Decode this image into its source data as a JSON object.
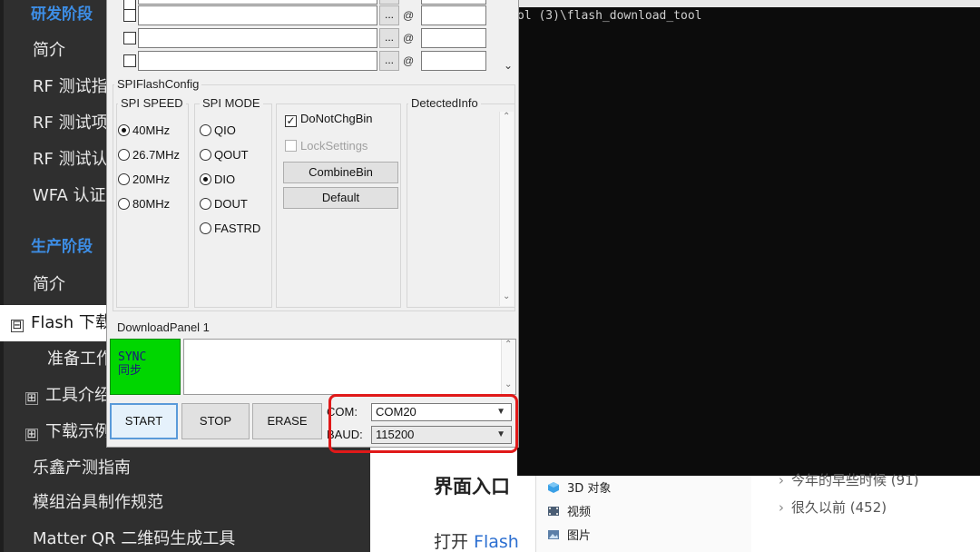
{
  "sidebar": {
    "items": [
      {
        "label": "研发阶段",
        "type": "section"
      },
      {
        "label": "简介",
        "type": "link"
      },
      {
        "label": "RF 测试指",
        "type": "link"
      },
      {
        "label": "RF 测试项",
        "type": "link"
      },
      {
        "label": "RF 测试认",
        "type": "link"
      },
      {
        "label": "WFA 认证",
        "type": "link"
      },
      {
        "label": "生产阶段",
        "type": "section"
      },
      {
        "label": "简介",
        "type": "link"
      },
      {
        "label": "Flash 下载",
        "type": "link",
        "toggle": "⊟",
        "active": true
      },
      {
        "label": "准备工作",
        "type": "link"
      },
      {
        "label": "工具介绍",
        "type": "link",
        "toggle": "⊞"
      },
      {
        "label": "下载示例",
        "type": "link",
        "toggle": "⊞"
      },
      {
        "label": "乐鑫产测指南",
        "type": "link"
      },
      {
        "label": "模组治具制作规范",
        "type": "link"
      },
      {
        "label": "Matter QR 二维码生成工具",
        "type": "link"
      }
    ]
  },
  "doc": {
    "heading": "界面入口",
    "text_prefix": "打开 ",
    "text_link": "Flash"
  },
  "terminal": {
    "line": "ol (3)\\flash_download_tool"
  },
  "explorer": {
    "nav": [
      {
        "label": "3D 对象",
        "icon": "3d-objects-icon"
      },
      {
        "label": "视频",
        "icon": "video-icon"
      },
      {
        "label": "图片",
        "icon": "pictures-icon"
      }
    ],
    "groups": [
      {
        "label": "今年的早些时候 (91)"
      },
      {
        "label": "很久以前 (452)"
      }
    ]
  },
  "tool": {
    "file_rows": 4,
    "dots_label": "...",
    "at_label": "@",
    "spi_flash_config_title": "SPIFlashConfig",
    "spi_speed": {
      "title": "SPI SPEED",
      "options": [
        "40MHz",
        "26.7MHz",
        "20MHz",
        "80MHz"
      ],
      "selected": "40MHz"
    },
    "spi_mode": {
      "title": "SPI MODE",
      "options": [
        "QIO",
        "QOUT",
        "DIO",
        "DOUT",
        "FASTRD"
      ],
      "selected": "DIO"
    },
    "donotchgbin": {
      "label": "DoNotChgBin",
      "checked": true
    },
    "locksettings": {
      "label": "LockSettings",
      "checked": false,
      "disabled": true
    },
    "combinebin_label": "CombineBin",
    "default_label": "Default",
    "detected_info_title": "DetectedInfo",
    "download_panel_title": "DownloadPanel 1",
    "sync_line1": "SYNC",
    "sync_line2": "同步",
    "start_label": "START",
    "stop_label": "STOP",
    "erase_label": "ERASE",
    "com_label": "COM:",
    "com_value": "COM20",
    "baud_label": "BAUD:",
    "baud_value": "115200",
    "checkmark": "✓"
  },
  "colors": {
    "sidebar_bg": "#2f2f2f",
    "section_blue": "#3d8ee6",
    "sync_green": "#00d600",
    "highlight_red": "#e01919",
    "terminal_bg": "#0c0c0c"
  }
}
